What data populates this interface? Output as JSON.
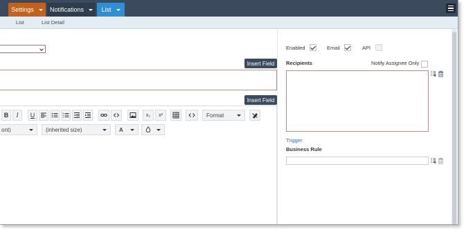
{
  "topnav": {
    "settings_label": "Settings",
    "notifications_label": "Notifications",
    "list_label": "List"
  },
  "subnav": {
    "items": [
      "List",
      "List Detail"
    ]
  },
  "left": {
    "insert_field_1": "Insert Field",
    "insert_field_2": "Insert Field",
    "toolbar": {
      "bold": "B",
      "italic": "I",
      "underline": "U",
      "subscript": "x₂",
      "superscript": "x²",
      "format_label": "Format",
      "font_value": "ont)",
      "size_value": "(inherited size)",
      "color_label": "A"
    }
  },
  "right": {
    "enabled_label": "Enabled",
    "email_label": "Email",
    "api_label": "API",
    "recipients_label": "Recipients",
    "notify_assignee_label": "Notify Assignee Only",
    "trigger_label": "Trigger",
    "business_rule_label": "Business Rule",
    "enabled_checked": true,
    "email_checked": true,
    "api_checked": false,
    "notify_assignee_checked": false
  },
  "colors": {
    "nav_bg": "#3b4a5c",
    "settings_bg": "#c2621f",
    "list_active_bg": "#2f8fd2",
    "field_border": "#c08a8a",
    "link": "#2f6ea8"
  }
}
